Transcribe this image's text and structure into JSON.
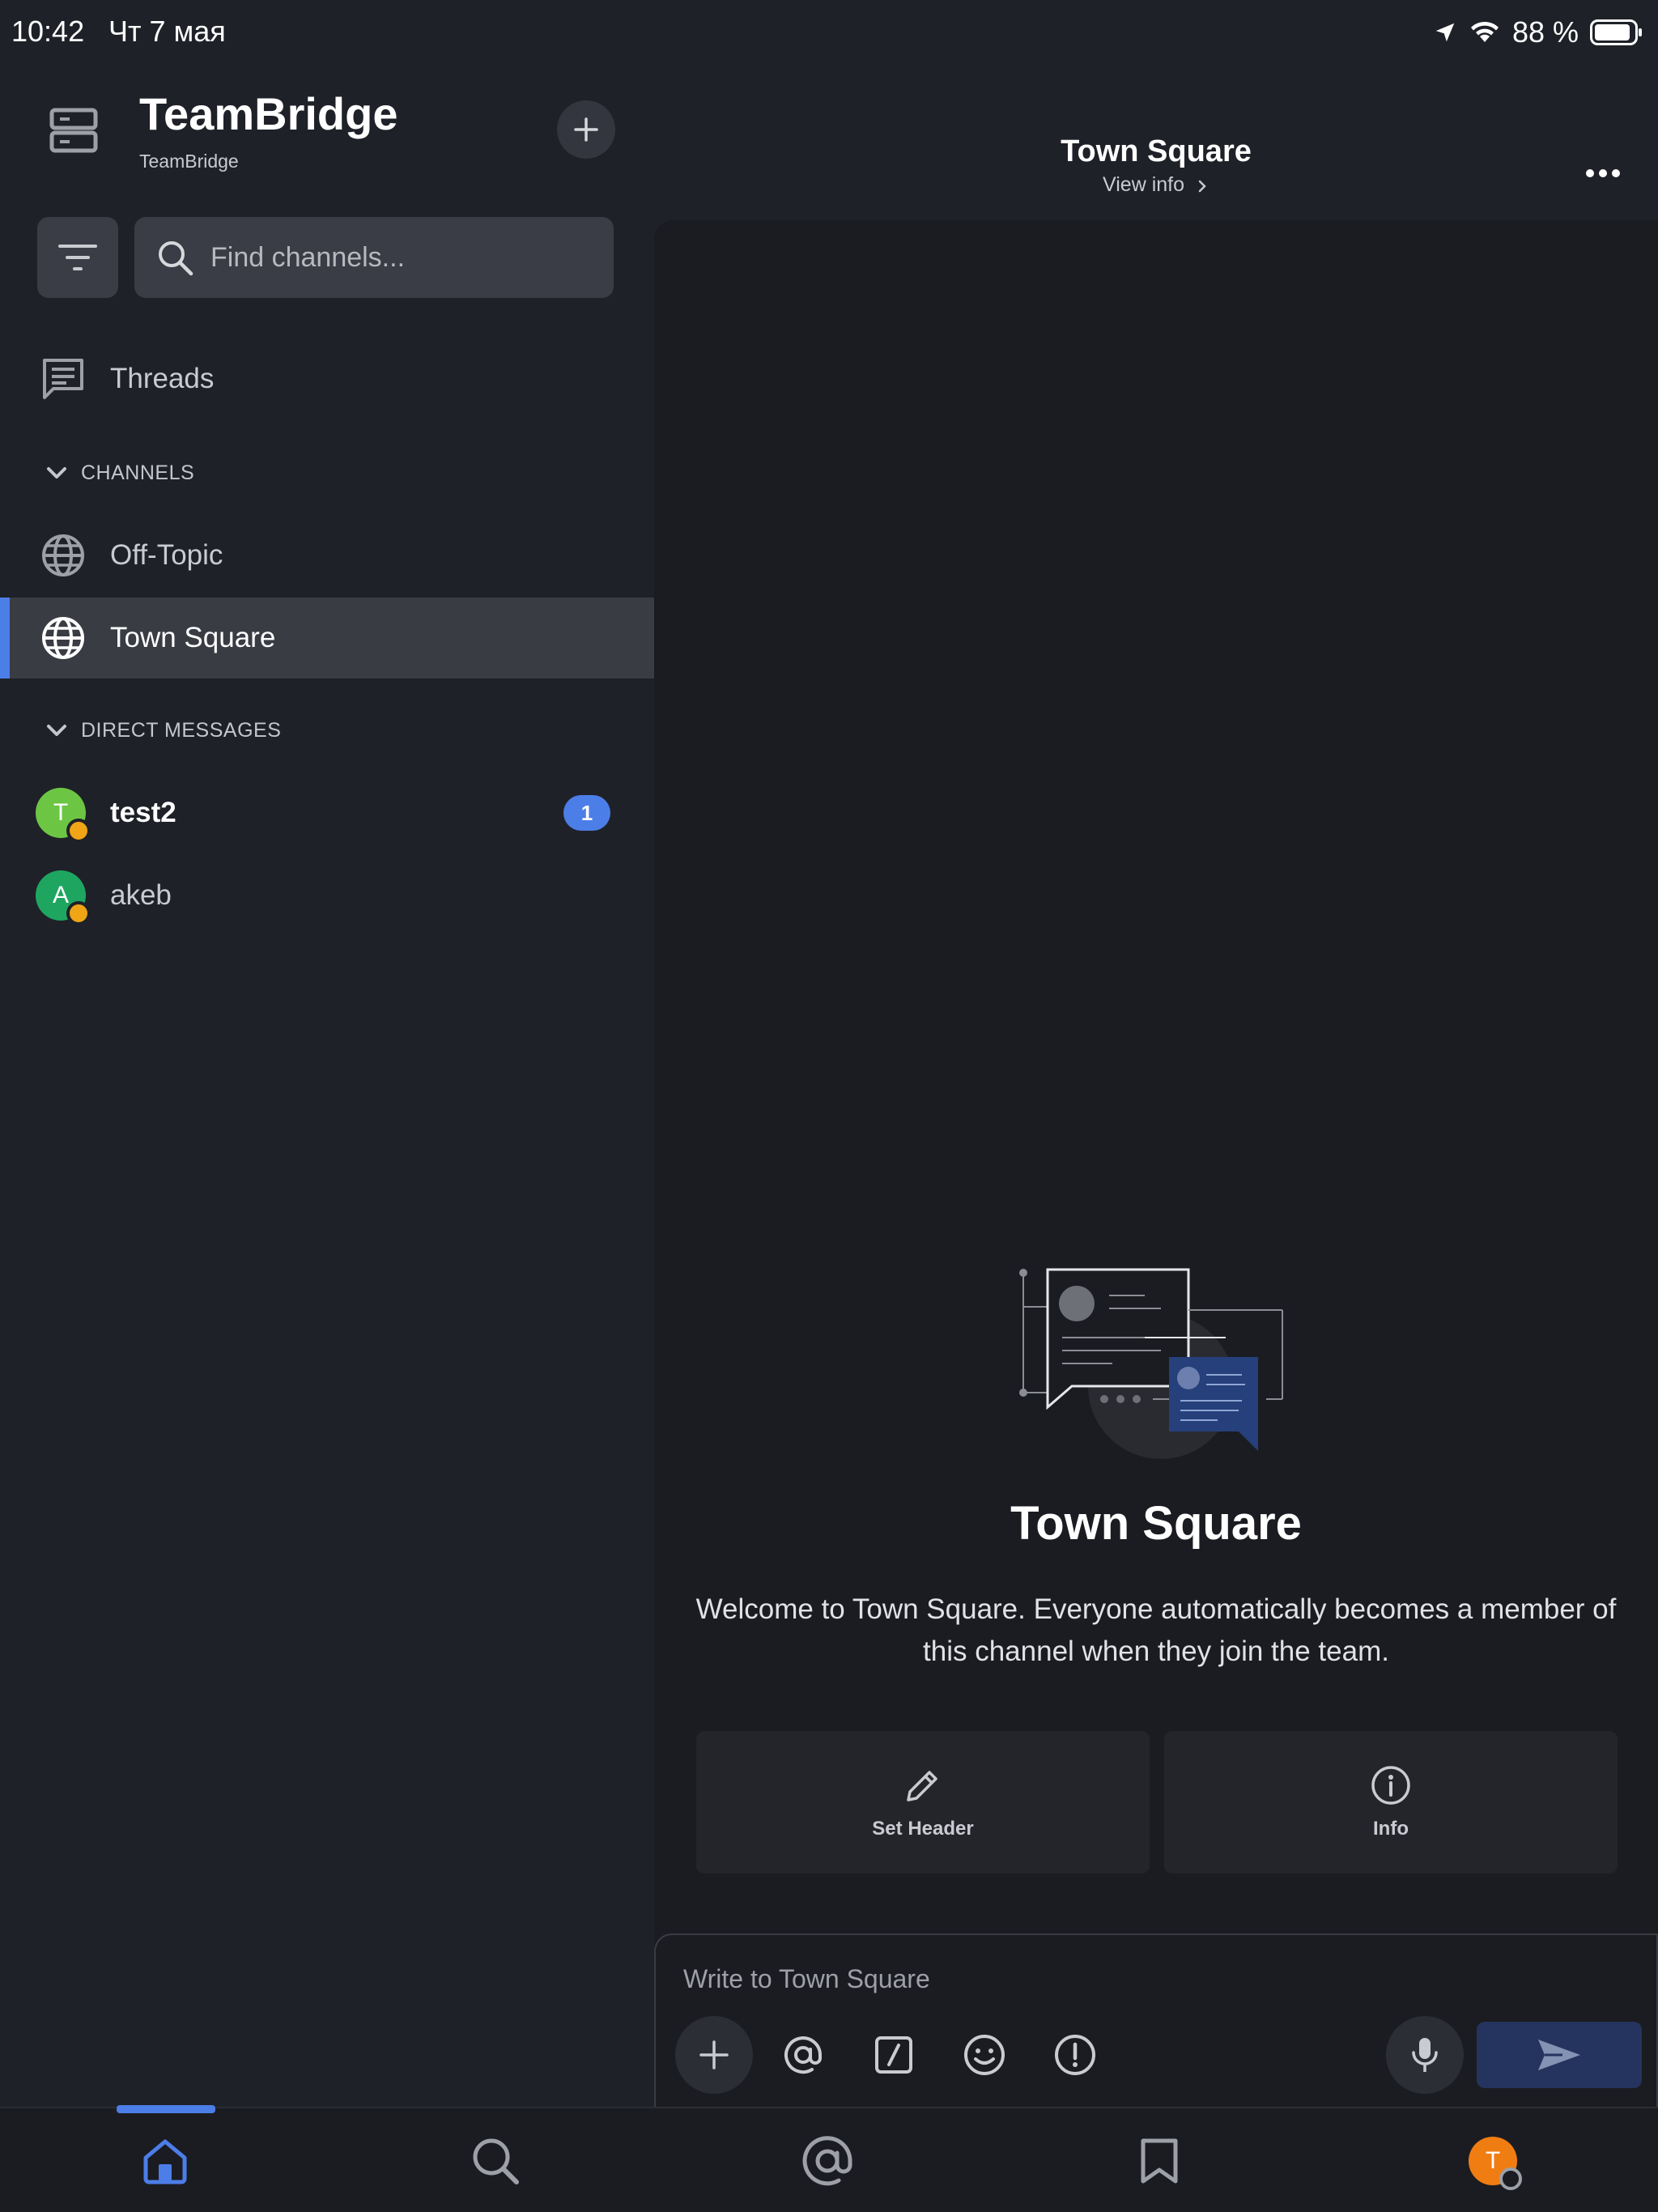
{
  "status": {
    "time": "10:42",
    "date": "Чт 7 мая",
    "battery": "88 %"
  },
  "sidebar": {
    "team_name": "TeamBridge",
    "team_subtitle": "TeamBridge",
    "search_placeholder": "Find channels...",
    "threads_label": "Threads",
    "channels_header": "CHANNELS",
    "channels": [
      {
        "label": "Off-Topic",
        "active": false
      },
      {
        "label": "Town Square",
        "active": true
      }
    ],
    "dm_header": "DIRECT MESSAGES",
    "dms": [
      {
        "label": "test2",
        "initial": "T",
        "color": "#6cc644",
        "unread": "1",
        "bold": true
      },
      {
        "label": "akeb",
        "initial": "A",
        "color": "#1ea660",
        "unread": null,
        "bold": false
      }
    ]
  },
  "channel": {
    "title": "Town Square",
    "view_info": "View info",
    "intro_title": "Town Square",
    "intro_text": "Welcome to Town Square. Everyone automatically becomes a member of this channel when they join the team.",
    "actions": [
      {
        "label": "Set Header",
        "icon": "pencil-icon"
      },
      {
        "label": "Info",
        "icon": "info-icon"
      }
    ],
    "composer_placeholder": "Write to Town Square"
  },
  "profile_initial": "T",
  "colors": {
    "accent": "#4c7ee8",
    "background": "#1f2128",
    "main_background": "#1b1c21",
    "away": "#f0a516",
    "profile": "#f07d12"
  }
}
